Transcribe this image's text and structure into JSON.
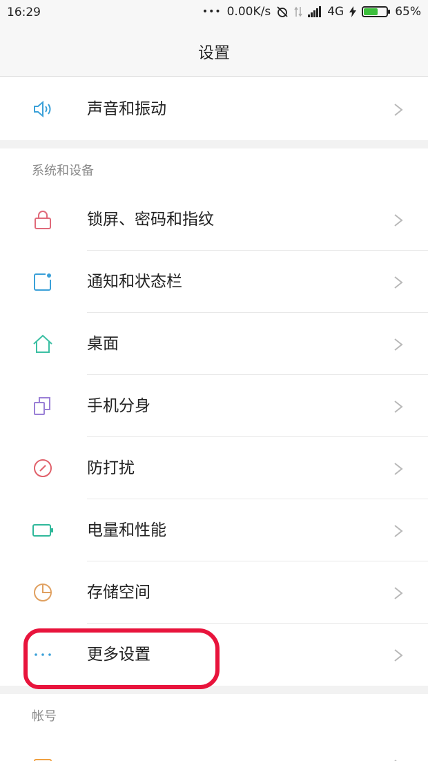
{
  "status_bar": {
    "time": "16:29",
    "dots": "•••",
    "net_speed": "0.00K/s",
    "network": "4G",
    "battery_percent": "65%",
    "battery_level": 0.65
  },
  "header": {
    "title": "设置"
  },
  "top_group": {
    "items": [
      {
        "label": "声音和振动",
        "icon": "speaker-icon"
      }
    ]
  },
  "system_section": {
    "header": "系统和设备",
    "items": [
      {
        "label": "锁屏、密码和指纹",
        "icon": "lock-icon",
        "color": "#e06a7a"
      },
      {
        "label": "通知和状态栏",
        "icon": "notification-icon",
        "color": "#3aa0d8"
      },
      {
        "label": "桌面",
        "icon": "home-icon",
        "color": "#3bbfa3"
      },
      {
        "label": "手机分身",
        "icon": "dual-copy-icon",
        "color": "#9a7fd6"
      },
      {
        "label": "防打扰",
        "icon": "do-not-disturb-icon",
        "color": "#e0606a"
      },
      {
        "label": "电量和性能",
        "icon": "battery-icon",
        "color": "#2fb89a"
      },
      {
        "label": "存储空间",
        "icon": "storage-pie-icon",
        "color": "#e0a060"
      },
      {
        "label": "更多设置",
        "icon": "more-dots-icon",
        "color": "#3aa0d8"
      }
    ]
  },
  "account_section": {
    "header": "帐号"
  },
  "colors": {
    "accent_annotation": "#e8143c",
    "speaker": "#3aa0d8"
  }
}
